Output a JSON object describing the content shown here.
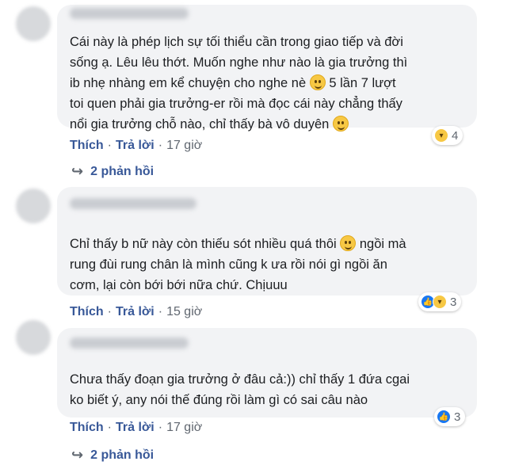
{
  "comments": [
    {
      "lines": [
        "Cái này là phép lịch sự tối thiểu cần trong giao tiếp và đời",
        "sống ạ. Lêu lêu thớt. Muốn nghe như nào là gia trưởng thì",
        "ib nhẹ nhàng em kể chuyện cho nghe nè",
        "toi quen phải gia trưởng-er rồi mà đọc cái này chẳng thấy",
        "nổi gia trưởng chỗ nào, chỉ thấy bà vô duyên"
      ],
      "line3_tail": "5 lần 7 lượt",
      "reaction_count": "4",
      "like": "Thích",
      "reply": "Trả lời",
      "sep": "·",
      "time": "17 giờ",
      "replies_label": "2 phản hồi"
    },
    {
      "lines": [
        "Chỉ thấy b nữ này còn thiếu sót nhiều quá thôi",
        "rung đùi rung chân là mình cũng k ưa rồi nói gì ngồi ăn",
        "cơm, lại còn bới bới nữa chứ. Chịuuu"
      ],
      "line1_tail": "ngồi mà",
      "reaction_count": "3",
      "like": "Thích",
      "reply": "Trả lời",
      "sep": "·",
      "time": "15 giờ"
    },
    {
      "lines": [
        "Chưa thấy đoạn gia trưởng ở đâu cả:)) chỉ thấy 1 đứa cgai",
        "ko biết ý, any nói thế đúng rồi làm gì có sai câu nào"
      ],
      "reaction_count": "3",
      "like": "Thích",
      "reply": "Trả lời",
      "sep": "·",
      "time": "17 giờ",
      "replies_label": "2 phản hồi"
    }
  ],
  "colors": {
    "bubble": "#f2f3f5",
    "link": "#385898",
    "meta": "#606770",
    "like_blue": "#1877f2",
    "haha_yellow": "#f7c844"
  },
  "icons": {
    "smile": "smile-emoji-icon",
    "laugh": "laugh-crying-emoji-icon",
    "like": "like-reaction-icon",
    "haha": "haha-reaction-icon",
    "reply_arrow": "reply-arrow-icon"
  }
}
